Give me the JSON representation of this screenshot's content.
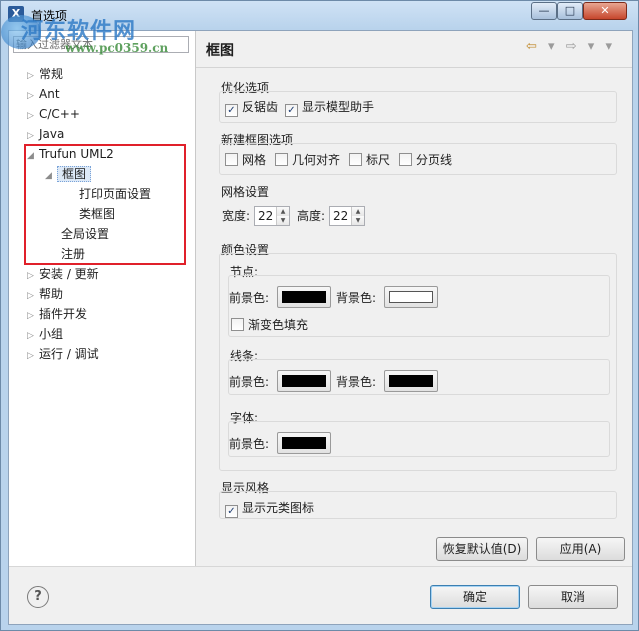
{
  "window": {
    "title": "首选项",
    "app_icon": "X",
    "minimize": "—",
    "maximize": "□",
    "close": "✕"
  },
  "watermark": {
    "line1": "河东软件网",
    "line2": "www.pc0359.cn"
  },
  "filter": {
    "placeholder": "输入过滤器文本"
  },
  "tree": {
    "items": [
      {
        "label": "常规",
        "arrow": "▷"
      },
      {
        "label": "Ant",
        "arrow": "▷"
      },
      {
        "label": "C/C++",
        "arrow": "▷"
      },
      {
        "label": "Java",
        "arrow": "▷"
      },
      {
        "label": "Trufun UML2",
        "arrow": "◢"
      },
      {
        "label": "框图",
        "arrow": "◢"
      },
      {
        "label": "打印页面设置",
        "arrow": ""
      },
      {
        "label": "类框图",
        "arrow": ""
      },
      {
        "label": "全局设置",
        "arrow": ""
      },
      {
        "label": "注册",
        "arrow": ""
      },
      {
        "label": "安装 / 更新",
        "arrow": "▷"
      },
      {
        "label": "帮助",
        "arrow": "▷"
      },
      {
        "label": "插件开发",
        "arrow": "▷"
      },
      {
        "label": "小组",
        "arrow": "▷"
      },
      {
        "label": "运行 / 调试",
        "arrow": "▷"
      }
    ]
  },
  "page": {
    "title": "框图",
    "nav": {
      "back": "⇦",
      "back_menu": "▾",
      "forward": "⇨",
      "forward_menu": "▾",
      "view_menu": "▾"
    }
  },
  "optimize": {
    "label": "优化选项",
    "antialias": "反锯齿",
    "antialias_checked": true,
    "model_assistant": "显示模型助手",
    "model_assistant_checked": true
  },
  "new_diagram": {
    "label": "新建框图选项",
    "grid": "网格",
    "geometric_align": "几何对齐",
    "ruler": "标尺",
    "page_break": "分页线",
    "grid_checked": false,
    "geometric_align_checked": false,
    "ruler_checked": false,
    "page_break_checked": false
  },
  "grid_settings": {
    "label": "网格设置",
    "width_label": "宽度:",
    "width_value": "22",
    "height_label": "高度:",
    "height_value": "22",
    "spin_up": "▲",
    "spin_down": "▼"
  },
  "colors": {
    "label": "颜色设置",
    "node": {
      "label": "节点:",
      "fg_label": "前景色:",
      "bg_label": "背景色:",
      "fg_color": "#000000",
      "bg_color": "#ffffff",
      "gradient_fill": "渐变色填充",
      "gradient_fill_checked": false
    },
    "line": {
      "label": "线条:",
      "fg_label": "前景色:",
      "bg_label": "背景色:",
      "fg_color": "#000000",
      "bg_color": "#000000"
    },
    "font": {
      "label": "字体:",
      "fg_label": "前景色:",
      "fg_color": "#000000"
    }
  },
  "display_style": {
    "label": "显示风格",
    "show_element_icon": "显示元类图标",
    "show_element_icon_checked": true
  },
  "buttons": {
    "restore_defaults": "恢复默认值(D)",
    "apply": "应用(A)",
    "ok": "确定",
    "cancel": "取消",
    "help": "?"
  },
  "check_mark": "✓"
}
